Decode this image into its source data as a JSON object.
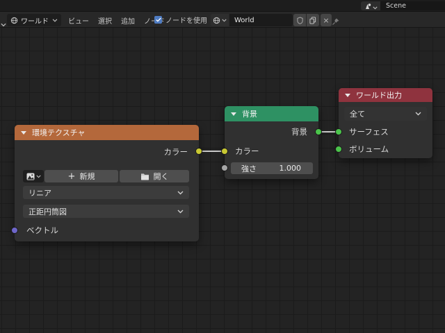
{
  "topbar": {
    "scene": {
      "value": "Scene"
    }
  },
  "editor_header": {
    "shader_type": "ワールド",
    "menus": [
      "ビュー",
      "選択",
      "追加",
      "ノード"
    ],
    "use_nodes_label": "ノードを使用",
    "use_nodes_checked": true,
    "id_name": "World",
    "close_glyph": "×"
  },
  "nodes": {
    "env_texture": {
      "title": "環境テクスチャ",
      "output_color": "カラー",
      "new_label": "新規",
      "plus_glyph": "+",
      "open_label": "開く",
      "interpolation": "リニア",
      "projection": "正距円筒図",
      "input_vector": "ベクトル"
    },
    "background": {
      "title": "背景",
      "output": "背景",
      "input_color": "カラー",
      "strength_label": "強さ",
      "strength_value": "1.000"
    },
    "world_output": {
      "title": "ワールド出力",
      "target": "全て",
      "input_surface": "サーフェス",
      "input_volume": "ボリューム"
    }
  },
  "colors": {
    "env_header": "#b4683b",
    "background_header": "#2e9163",
    "output_header": "#8f333e",
    "socket_yellow": "#c8c832",
    "socket_shader": "#4bc44b",
    "socket_value": "#a6a6a6",
    "socket_vector": "#6e66c9",
    "link": "#cacaca",
    "checkbox": "#4f7cc2"
  }
}
